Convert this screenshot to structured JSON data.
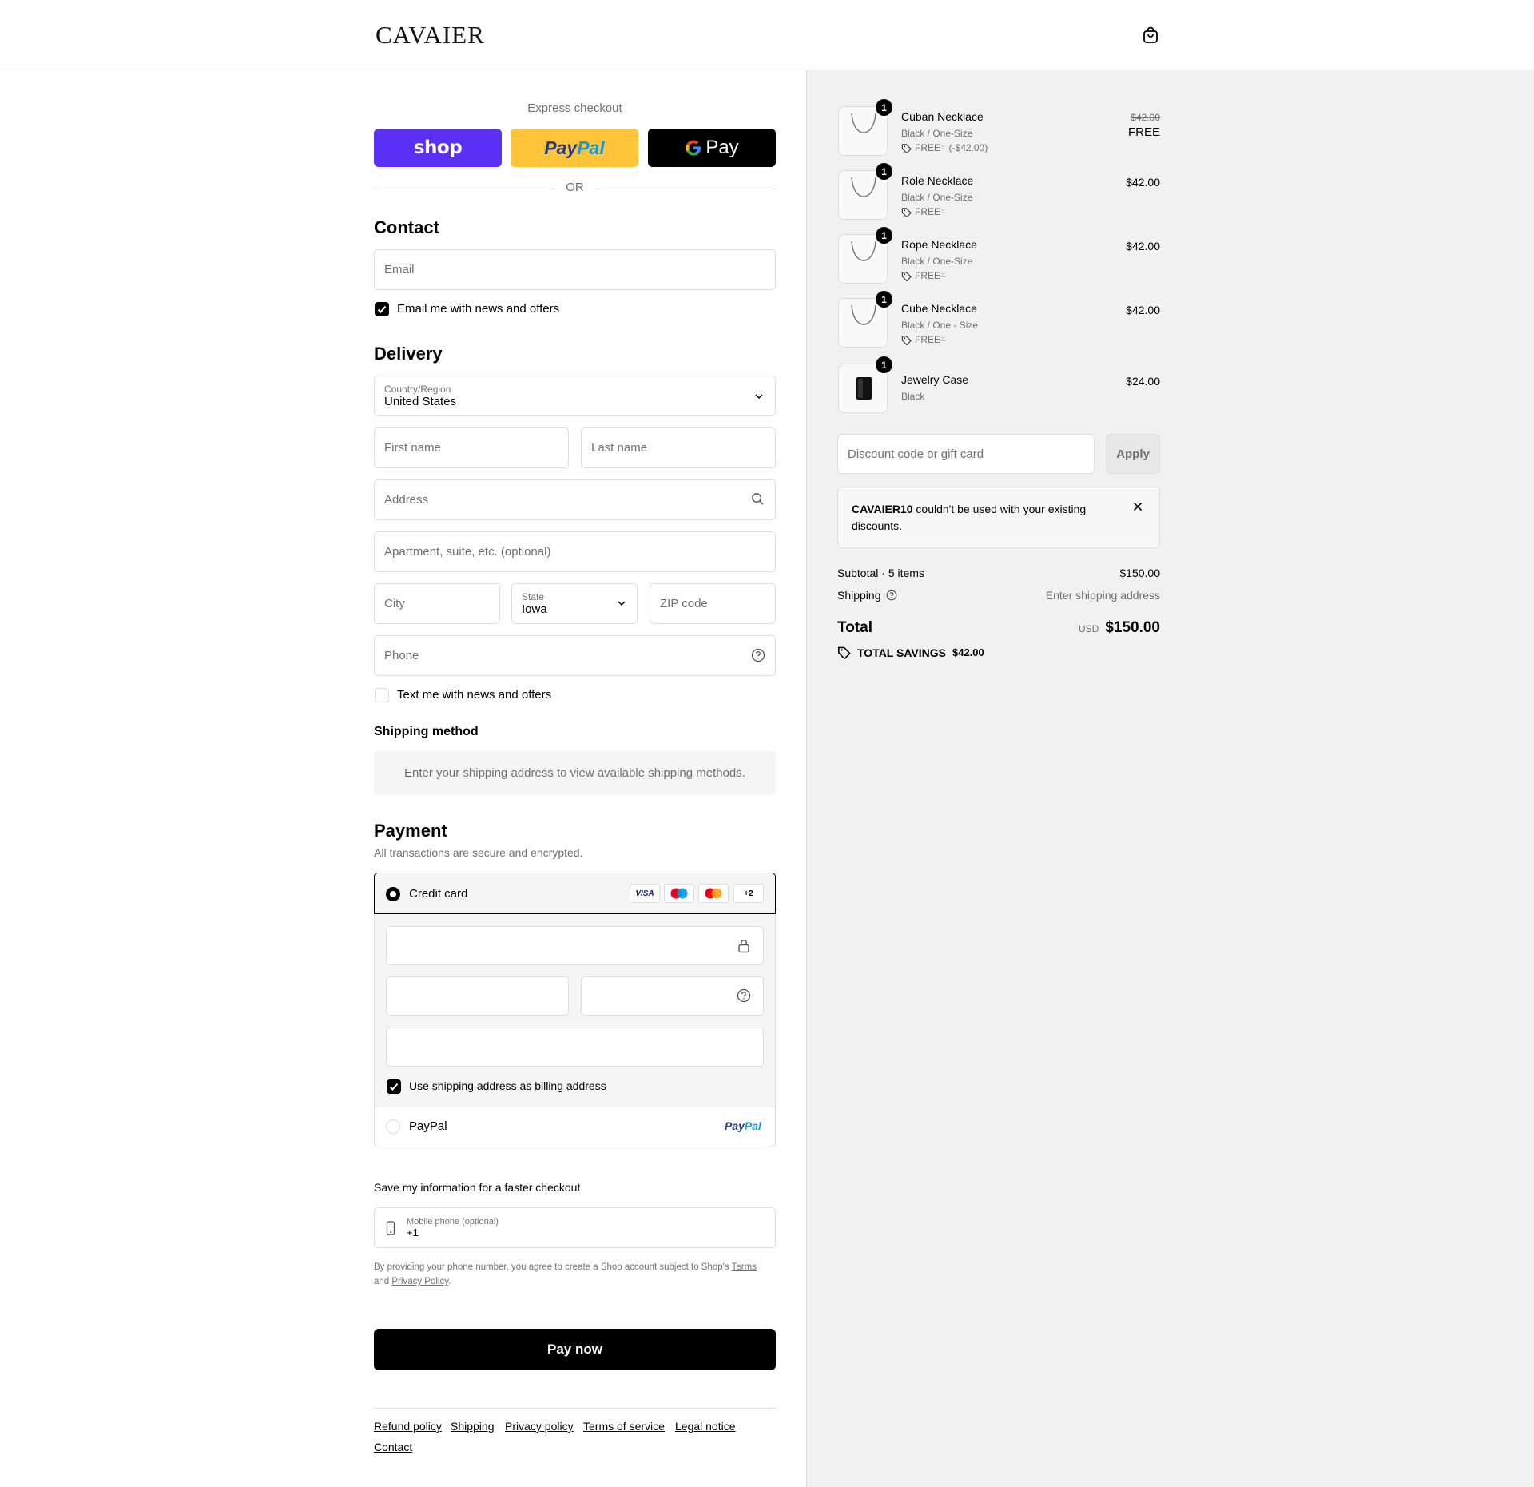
{
  "header": {
    "logo": "CAVAIER",
    "cart_icon": "shopping-bag-icon"
  },
  "express": {
    "label": "Express checkout",
    "shop_label": "shop",
    "paypal_label": "PayPal",
    "gpay_label": "Pay",
    "or_label": "OR"
  },
  "contact": {
    "title": "Contact",
    "email_placeholder": "Email",
    "news_label": "Email me with news and offers",
    "news_checked": true
  },
  "delivery": {
    "title": "Delivery",
    "country_label": "Country/Region",
    "country_value": "United States",
    "first_name": "First name",
    "last_name": "Last name",
    "address": "Address",
    "apartment": "Apartment, suite, etc. (optional)",
    "city": "City",
    "state_label": "State",
    "state_value": "Iowa",
    "zip": "ZIP code",
    "phone": "Phone",
    "text_label": "Text me with news and offers",
    "text_checked": false
  },
  "shipping_method": {
    "title": "Shipping method",
    "message": "Enter your shipping address to view available shipping methods."
  },
  "payment": {
    "title": "Payment",
    "subtitle": "All transactions are secure and encrypted.",
    "credit_card_label": "Credit card",
    "card_logos": [
      "VISA",
      "maestro",
      "mastercard",
      "+2"
    ],
    "billing_label": "Use shipping address as billing address",
    "billing_checked": true,
    "paypal_label": "PayPal",
    "paypal_logo": "PayPal"
  },
  "save_info": {
    "title": "Save my information for a faster checkout",
    "mobile_label": "Mobile phone (optional)",
    "mobile_value": "+1",
    "legal_prefix": "By providing your phone number, you agree to create a Shop account subject to Shop's",
    "terms_link": "Terms",
    "legal_and": "and",
    "privacy_link": "Privacy Policy",
    "legal_suffix": "."
  },
  "pay_now": "Pay now",
  "footer_links": [
    "Refund policy",
    "Shipping",
    "Privacy policy",
    "Terms of service",
    "Legal notice",
    "Contact"
  ],
  "order": {
    "items": [
      {
        "name": "Cuban Necklace",
        "variant": "Black / One-Size",
        "discount": "FREE⍨ (-$42.00)",
        "original_price": "$42.00",
        "price": "FREE",
        "qty": "1"
      },
      {
        "name": "Role Necklace",
        "variant": "Black / One-Size",
        "discount": "FREE⍨",
        "price": "$42.00",
        "qty": "1"
      },
      {
        "name": "Rope Necklace",
        "variant": "Black / One-Size",
        "discount": "FREE⍨",
        "price": "$42.00",
        "qty": "1"
      },
      {
        "name": "Cube Necklace",
        "variant": "Black / One - Size",
        "discount": "FREE⍨",
        "price": "$42.00",
        "qty": "1"
      },
      {
        "name": "Jewelry Case",
        "variant": "Black",
        "price": "$24.00",
        "qty": "1"
      }
    ],
    "discount_placeholder": "Discount code or gift card",
    "apply_label": "Apply",
    "notice_code": "CAVAIER10",
    "notice_text": "couldn't be used with your existing discounts.",
    "subtotal_label": "Subtotal · 5 items",
    "subtotal_value": "$150.00",
    "shipping_label": "Shipping",
    "shipping_value": "Enter shipping address",
    "total_label": "Total",
    "currency": "USD",
    "total_value": "$150.00",
    "savings_label": "TOTAL SAVINGS",
    "savings_value": "$42.00"
  }
}
